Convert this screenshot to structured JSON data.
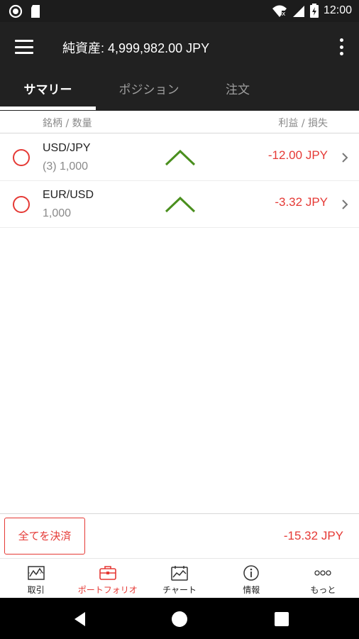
{
  "status_bar": {
    "time": "12:00",
    "icons": [
      "circle-status-icon",
      "sd-card-icon",
      "wifi-icon",
      "signal-icon",
      "battery-icon"
    ]
  },
  "app_bar": {
    "title": "純資産: 4,999,982.00 JPY",
    "menu_icon": "hamburger-menu-icon",
    "overflow_icon": "overflow-menu-icon"
  },
  "tabs": [
    {
      "label": "サマリー",
      "active": true
    },
    {
      "label": "ポジション",
      "active": false
    },
    {
      "label": "注文",
      "active": false
    }
  ],
  "column_headers": {
    "left": "銘柄 / 数量",
    "right": "利益 / 損失"
  },
  "positions": [
    {
      "symbol": "USD/JPY",
      "quantity": "(3) 1,000",
      "trend": "up",
      "pl": "-12.00 JPY"
    },
    {
      "symbol": "EUR/USD",
      "quantity": "1,000",
      "trend": "up",
      "pl": "-3.32 JPY"
    }
  ],
  "footer": {
    "close_all_label": "全てを決済",
    "total_pl": "-15.32 JPY"
  },
  "bottom_nav": [
    {
      "label": "取引",
      "icon": "trade-chart-icon",
      "active": false
    },
    {
      "label": "ポートフォリオ",
      "icon": "briefcase-icon",
      "active": true
    },
    {
      "label": "チャート",
      "icon": "chart-icon",
      "active": false
    },
    {
      "label": "情報",
      "icon": "info-icon",
      "active": false
    },
    {
      "label": "もっと",
      "icon": "more-dots-icon",
      "active": false
    }
  ],
  "colors": {
    "accent_red": "#e53935",
    "trend_green": "#4a8f1e",
    "app_bar_bg": "#212121"
  }
}
